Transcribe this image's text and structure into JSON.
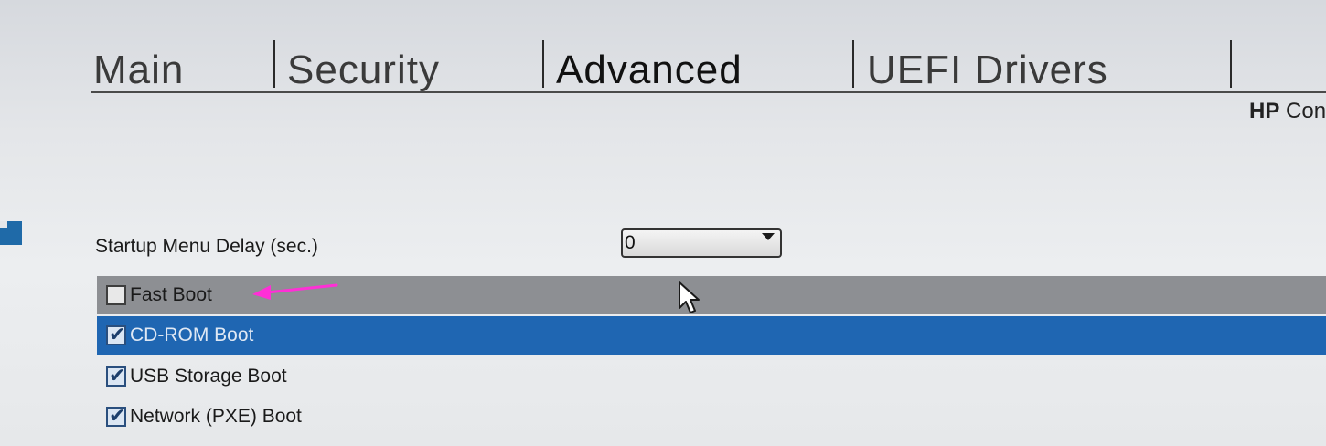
{
  "tabs": [
    {
      "label": "Main",
      "active": false
    },
    {
      "label": "Security",
      "active": false
    },
    {
      "label": "Advanced",
      "active": true
    },
    {
      "label": "UEFI Drivers",
      "active": false
    }
  ],
  "brand": {
    "bold": "HP",
    "rest": "Con"
  },
  "startup_delay": {
    "label": "Startup Menu Delay (sec.)",
    "value": "0"
  },
  "options": [
    {
      "label": "Fast Boot",
      "checked": false,
      "state": "hover"
    },
    {
      "label": "CD-ROM Boot",
      "checked": true,
      "state": "selected"
    },
    {
      "label": "USB Storage Boot",
      "checked": true,
      "state": "normal"
    },
    {
      "label": "Network (PXE) Boot",
      "checked": true,
      "state": "normal"
    }
  ],
  "icons": {
    "checkmark": "checkmark-icon",
    "dropdown": "chevron-down-icon",
    "pointer": "mouse-pointer-icon",
    "annotation": "arrow-left-icon"
  },
  "colors": {
    "selected_row": "#1f66b2",
    "hover_row": "#8d8f93",
    "annotation_arrow": "#ff2fd6",
    "marker": "#1f6aa8"
  }
}
